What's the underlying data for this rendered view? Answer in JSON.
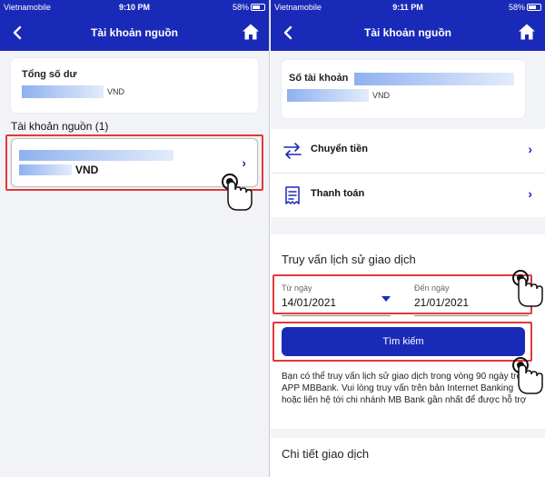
{
  "status_left": {
    "carrier": "Vietnamobile",
    "time": "9:10 PM",
    "battery": "58%"
  },
  "status_right": {
    "carrier": "Vietnamobile",
    "time": "9:11 PM",
    "battery": "58%"
  },
  "left": {
    "title": "Tài khoản nguồn",
    "balance_label": "Tổng số dư",
    "balance_currency": "VND",
    "accounts_heading": "Tài khoản nguồn (1)",
    "account_currency": "VND"
  },
  "right": {
    "title": "Tài khoản nguồn",
    "account_number_label": "Số tài khoản",
    "account_currency": "VND",
    "menu": [
      {
        "label": "Chuyển tiền",
        "icon": "transfer-icon"
      },
      {
        "label": "Thanh toán",
        "icon": "receipt-icon"
      }
    ],
    "history_title": "Truy vấn lịch sử giao dịch",
    "from_label": "Từ ngày",
    "from_value": "14/01/2021",
    "to_label": "Đến ngày",
    "to_value": "21/01/2021",
    "search_button": "Tìm kiếm",
    "note": "Bạn có thể truy vấn lịch sử giao dịch trong vòng 90 ngày trên APP MBBank. Vui lòng truy vấn trên bản Internet Banking hoặc liên hệ tới chi nhánh MB Bank gần nhất để được hỗ trợ",
    "details_title": "Chi tiết giao dịch"
  },
  "colors": {
    "brand": "#1a2ab8",
    "highlight": "#e2393b"
  }
}
